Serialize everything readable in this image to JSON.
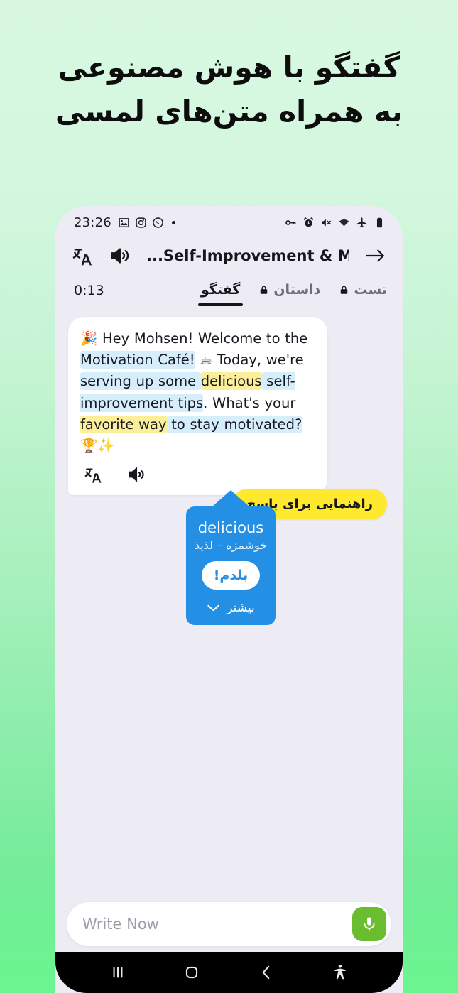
{
  "theme": {
    "bg_top": "#d8f8e2",
    "bg_bottom": "#6bf58f",
    "screen_bg": "#edecf4",
    "accent_blue": "#2390e5",
    "accent_yellow": "#ffe92e",
    "mic_green": "#6abd2f",
    "highlight_blue": "#d6eefb",
    "highlight_yellow": "#fbef9a"
  },
  "headline": {
    "line1": "گفتگو با هوش مصنوعی",
    "line2": "به همراه متن‌های لمسی"
  },
  "status_bar": {
    "time": "23:26",
    "left_icons": [
      "photo-icon",
      "instagram-icon",
      "whatsapp-icon",
      "dot-indicator"
    ],
    "right_icons": [
      "vpn-key-icon",
      "alarm-icon",
      "mute-icon",
      "wifi-icon",
      "airplane-mode-icon",
      "battery-icon"
    ]
  },
  "toolbar": {
    "translate_icon": "translate-icon",
    "speaker_icon": "speaker-icon",
    "title": "...Self-Improvement & Motiv",
    "arrow_icon": "arrow-right-icon"
  },
  "tabs_row": {
    "timer": "0:13",
    "tabs": [
      {
        "label": "گفتگو",
        "active": true,
        "locked": false
      },
      {
        "label": "داستان",
        "active": false,
        "locked": true
      },
      {
        "label": "تست",
        "active": false,
        "locked": true
      }
    ]
  },
  "message": {
    "emoji_party": "🎉",
    "seg1": "Hey Mohsen! Welcome to the ",
    "seg2_hl": "Motivation Café!",
    "emoji_coffee": "☕",
    "seg3": " Today, we're ",
    "seg4_hl": "serving up some ",
    "seg5_yellow": "delicious",
    "seg6_hl": " self-improvement tips",
    "seg7": ". What's your ",
    "seg8_yellow": "favorite way",
    "seg9_hl": " to stay motivated?",
    "emoji_trophy": "🏆",
    "emoji_sparkle": "✨",
    "action_translate_icon": "translate-icon",
    "action_speaker_icon": "speaker-icon"
  },
  "hint_pill": {
    "label": "راهنمایی برای پاسخ"
  },
  "word_popup": {
    "word": "delicious",
    "translation": "خوشمزه – لذیذ",
    "know_button": "بلدم!",
    "more_label": "بیشتر",
    "more_icon": "chevron-down-icon"
  },
  "composer": {
    "placeholder": "Write Now",
    "value": "",
    "mic_icon": "microphone-icon"
  },
  "nav_bar": {
    "recents_icon": "recents-icon",
    "home_icon": "home-icon",
    "back_icon": "back-icon",
    "accessibility_icon": "accessibility-icon"
  }
}
